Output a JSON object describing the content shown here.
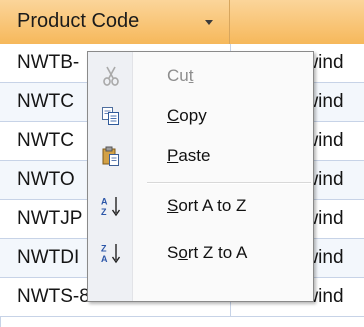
{
  "datasheet": {
    "column_header": "Product Code",
    "rows": [
      {
        "code": "NWTB-",
        "supplier": "Northwind"
      },
      {
        "code": "NWTC",
        "supplier": "Northwind"
      },
      {
        "code": "NWTC",
        "supplier": "Northwind"
      },
      {
        "code": "NWTO",
        "supplier": "Northwind"
      },
      {
        "code": "NWTJP",
        "supplier": "Northwind"
      },
      {
        "code": "NWTDI",
        "supplier": "Northwind"
      },
      {
        "code": "NWTS-8",
        "supplier": "Northwind"
      }
    ]
  },
  "context_menu": {
    "items": [
      {
        "label_pre": "Cu",
        "label_key": "t",
        "label_post": "",
        "icon": "cut-icon",
        "enabled": false
      },
      {
        "label_pre": "",
        "label_key": "C",
        "label_post": "opy",
        "icon": "copy-icon",
        "enabled": true
      },
      {
        "label_pre": "",
        "label_key": "P",
        "label_post": "aste",
        "icon": "paste-icon",
        "enabled": true
      },
      {
        "label_pre": "",
        "label_key": "S",
        "label_post": "ort A to Z",
        "icon": "sort-ascending-icon",
        "enabled": true
      },
      {
        "label_pre": "S",
        "label_key": "o",
        "label_post": "rt Z to A",
        "icon": "sort-descending-icon",
        "enabled": true
      }
    ]
  },
  "colors": {
    "header_top": "#fbd59a",
    "header_bottom": "#f6b85b",
    "gridline": "#c7d3e7",
    "menu_background": "#fafafa"
  }
}
